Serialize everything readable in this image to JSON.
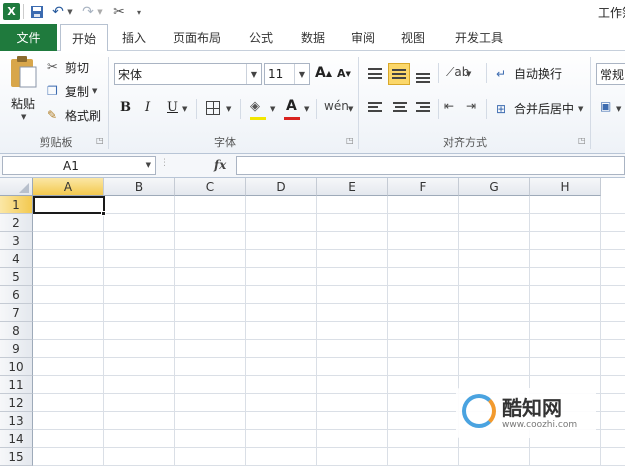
{
  "title_bar": {
    "doc_title": "工作簿"
  },
  "tabs": [
    "文件",
    "开始",
    "插入",
    "页面布局",
    "公式",
    "数据",
    "审阅",
    "视图",
    "开发工具"
  ],
  "clipboard": {
    "paste": "粘贴",
    "cut": "剪切",
    "copy": "复制",
    "format_painter": "格式刷",
    "group": "剪贴板"
  },
  "font": {
    "name": "宋体",
    "size": "11",
    "bold": "B",
    "italic": "I",
    "underline": "U",
    "font_color": "A",
    "group": "字体"
  },
  "alignment": {
    "wrap": "自动换行",
    "merge": "合并后居中",
    "group": "对齐方式"
  },
  "number": {
    "format": "常规"
  },
  "formula_bar": {
    "name_box": "A1",
    "fx": "fx",
    "value": ""
  },
  "columns": [
    "A",
    "B",
    "C",
    "D",
    "E",
    "F",
    "G",
    "H"
  ],
  "rows": [
    "1",
    "2",
    "3",
    "4",
    "5",
    "6",
    "7",
    "8",
    "9",
    "10",
    "11",
    "12",
    "13",
    "14",
    "15"
  ],
  "watermark": {
    "name": "酷知网",
    "url": "www.coozhi.com"
  },
  "colors": {
    "file_tab": "#1f7a3d",
    "selected_header": "#f3c94f",
    "font_color_bar": "#d9231f"
  }
}
